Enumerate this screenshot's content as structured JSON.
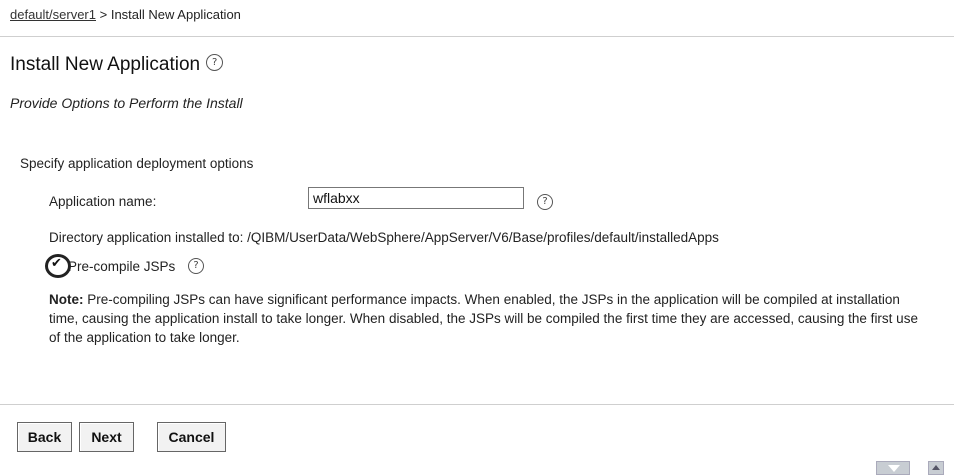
{
  "breadcrumb": {
    "link": "default/server1",
    "separator": " > ",
    "current": "Install New Application"
  },
  "page": {
    "title": "Install New Application",
    "subtitle": "Provide Options to Perform the Install",
    "help_glyph": "?"
  },
  "form": {
    "section_label": "Specify application deployment options",
    "app_name_label": "Application name:",
    "app_name_value": "wflabxx",
    "directory_label": "Directory application installed to:",
    "directory_value": "/QIBM/UserData/WebSphere/AppServer/V6/Base/profiles/default/installedApps",
    "precompile_label": "Pre-compile JSPs",
    "precompile_checked": true,
    "check_glyph": "✔",
    "note_label": "Note:",
    "note_text": "Pre-compiling JSPs can have significant performance impacts. When enabled, the JSPs in the application will be compiled at installation time, causing the application install to take longer. When disabled, the JSPs will be compiled the first time they are accessed, causing the first use of the application to take longer."
  },
  "buttons": {
    "back": "Back",
    "next": "Next",
    "cancel": "Cancel"
  },
  "icons": {
    "help": "help-icon",
    "scroll_down": "scroll-down-icon",
    "scroll_up": "scroll-up-icon"
  }
}
